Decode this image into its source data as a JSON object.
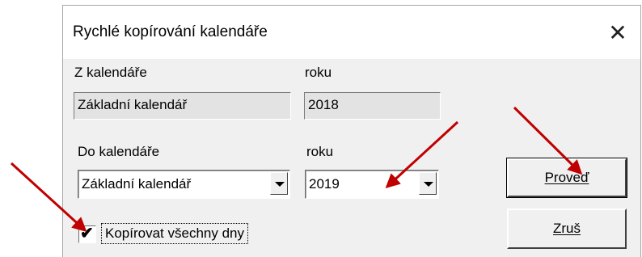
{
  "dialog": {
    "title": "Rychlé kopírování kalendáře",
    "close_icon": "close-icon"
  },
  "from": {
    "calendar_label": "Z kalendáře",
    "calendar_value": "Základní kalendář",
    "year_label": "roku",
    "year_value": "2018"
  },
  "to": {
    "calendar_label": "Do kalendáře",
    "calendar_value": "Základní kalendář",
    "year_label": "roku",
    "year_value": "2019"
  },
  "copy_all_days": {
    "label": "Kopírovat všechny dny",
    "checked": true
  },
  "buttons": {
    "execute_label": "Proveď",
    "cancel_label": "Zruš"
  },
  "annotation_color": "#c00000"
}
